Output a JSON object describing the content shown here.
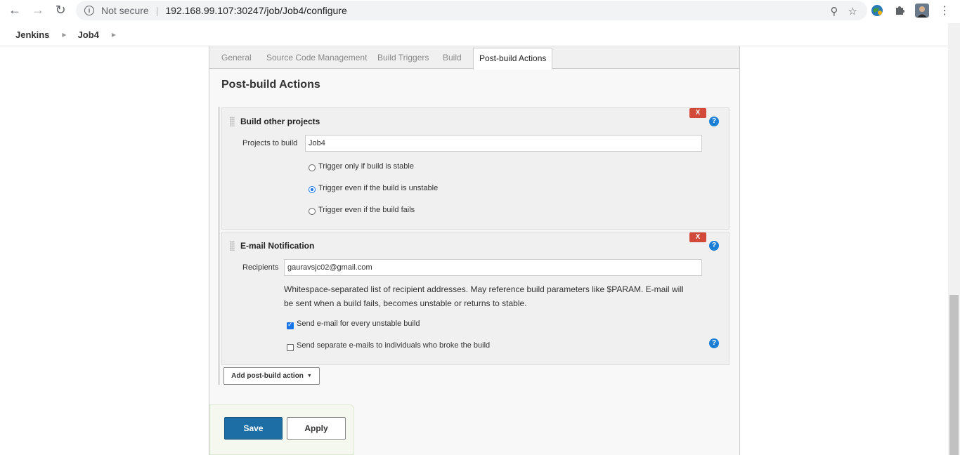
{
  "browser": {
    "security_label": "Not secure",
    "url": "192.168.99.107:30247/job/Job4/configure"
  },
  "breadcrumb": {
    "items": [
      "Jenkins",
      "Job4"
    ]
  },
  "tabs": [
    "General",
    "Source Code Management",
    "Build Triggers",
    "Build",
    "Post-build Actions"
  ],
  "active_tab": "Post-build Actions",
  "section_title": "Post-build Actions",
  "build_other_projects": {
    "title": "Build other projects",
    "delete_label": "X",
    "projects_label": "Projects to build",
    "projects_value": "Job4",
    "options": [
      {
        "label": "Trigger only if build is stable",
        "selected": false
      },
      {
        "label": "Trigger even if the build is unstable",
        "selected": true
      },
      {
        "label": "Trigger even if the build fails",
        "selected": false
      }
    ]
  },
  "email_notification": {
    "title": "E-mail Notification",
    "delete_label": "X",
    "recipients_label": "Recipients",
    "recipients_value": "gauravsjc02@gmail.com",
    "description_line1": "Whitespace-separated list of recipient addresses. May reference build parameters like $PARAM. E-mail will",
    "description_line2": "be sent when a build fails, becomes unstable or returns to stable.",
    "checkboxes": [
      {
        "label": "Send e-mail for every unstable build",
        "checked": true
      },
      {
        "label": "Send separate e-mails to individuals who broke the build",
        "checked": false
      }
    ]
  },
  "help_label": "?",
  "add_action_label": "Add post-build action",
  "save_label": "Save",
  "apply_label": "Apply",
  "colors": {
    "save": "#1c6ea4",
    "delete": "#d24939",
    "help": "#1c7fd6"
  }
}
